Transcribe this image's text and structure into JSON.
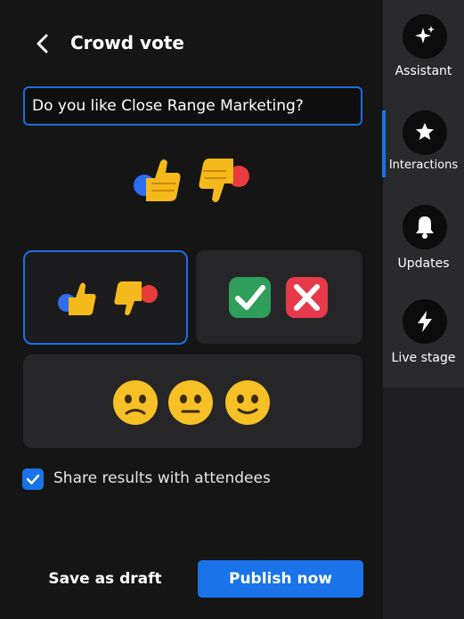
{
  "header": {
    "title": "Crowd vote"
  },
  "question": {
    "value": "Do you like Close Range Marketing?"
  },
  "options": [
    {
      "type": "thumbs up / thumbs down",
      "selected": true
    },
    {
      "type": "check / cross",
      "selected": false
    },
    {
      "type": "sad / neutral / happy",
      "selected": false
    }
  ],
  "share": {
    "label": "Share results with attendees",
    "checked": true
  },
  "actions": {
    "draft_label": "Save as draft",
    "publish_label": "Publish now"
  },
  "sidebar": {
    "items": [
      {
        "label": "Assistant",
        "icon": "sparkle-icon"
      },
      {
        "label": "Interactions",
        "icon": "star-icon",
        "active": true
      },
      {
        "label": "Updates",
        "icon": "bell-icon"
      },
      {
        "label": "Live stage",
        "icon": "lightning-icon"
      }
    ]
  },
  "colors": {
    "accent": "#1a73e8",
    "background": "#151515"
  }
}
